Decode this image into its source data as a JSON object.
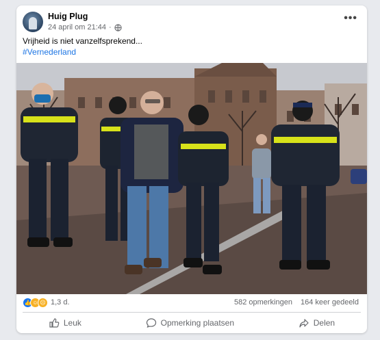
{
  "post": {
    "author": "Huig Plug",
    "timestamp": "24 april om 21:44",
    "dot": "·",
    "text": "Vrijheid is niet vanzelfsprekend...",
    "hashtag": "#Vernederland"
  },
  "stats": {
    "reaction_count": "1,3 d.",
    "comments": "582 opmerkingen",
    "shares": "164 keer gedeeld"
  },
  "actions": {
    "like": "Leuk",
    "comment": "Opmerking plaatsen",
    "share": "Delen"
  },
  "icons": {
    "privacy": "globe-icon",
    "more": "more-options-icon",
    "like": "thumbs-up-icon",
    "comment": "comment-bubble-icon",
    "share": "share-arrow-icon"
  },
  "colors": {
    "link": "#1b74e4",
    "like_reaction": "#1877f2"
  }
}
